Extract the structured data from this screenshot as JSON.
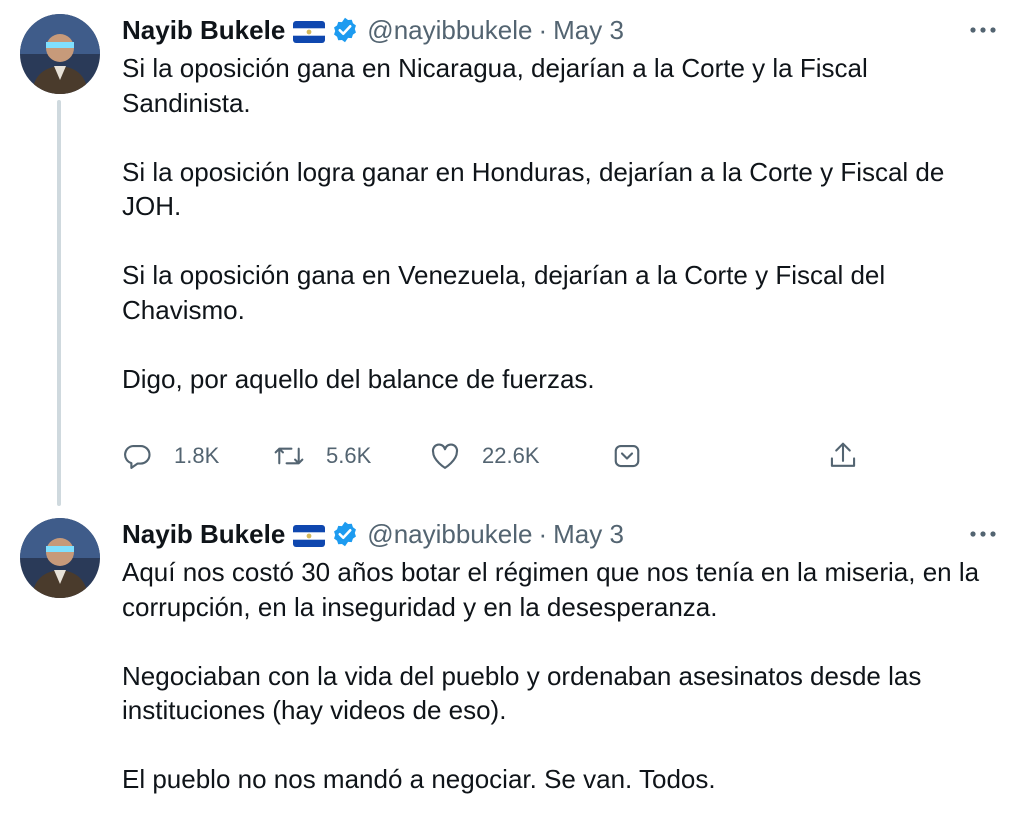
{
  "tweets": [
    {
      "author": {
        "name": "Nayib Bukele",
        "handle": "@nayibbukele",
        "separator": "·",
        "date": "May 3"
      },
      "paragraphs": [
        "Si la oposición gana en Nicaragua, dejarían a la Corte y la Fiscal Sandinista.",
        "Si la oposición logra ganar en Honduras, dejarían a la Corte y Fiscal de JOH.",
        "Si la oposición gana en Venezuela, dejarían a la Corte y Fiscal del Chavismo.",
        "Digo, por aquello del balance de fuerzas."
      ],
      "actions": {
        "replies": "1.8K",
        "retweets": "5.6K",
        "likes": "22.6K"
      }
    },
    {
      "author": {
        "name": "Nayib Bukele",
        "handle": "@nayibbukele",
        "separator": "·",
        "date": "May 3"
      },
      "paragraphs": [
        "Aquí nos costó 30 años botar el régimen que nos tenía en la miseria, en la corrupción, en la inseguridad y en la desesperanza.",
        "Negociaban con la vida del pueblo y ordenaban asesinatos desde las instituciones (hay videos de eso).",
        "El pueblo no nos mandó a negociar. Se van. Todos."
      ]
    }
  ],
  "icons": {
    "more": "more-horizontal-icon",
    "flag": "el-salvador-flag-icon",
    "verified": "verified-badge-icon",
    "reply": "reply-icon",
    "retweet": "retweet-icon",
    "like": "heart-icon",
    "tip": "tip-jar-icon",
    "share": "share-icon"
  },
  "colors": {
    "text": "#0f1419",
    "secondary": "#536471",
    "verified": "#1d9bf0",
    "thread_line": "#cfd9de",
    "flag_blue": "#0f47af"
  }
}
